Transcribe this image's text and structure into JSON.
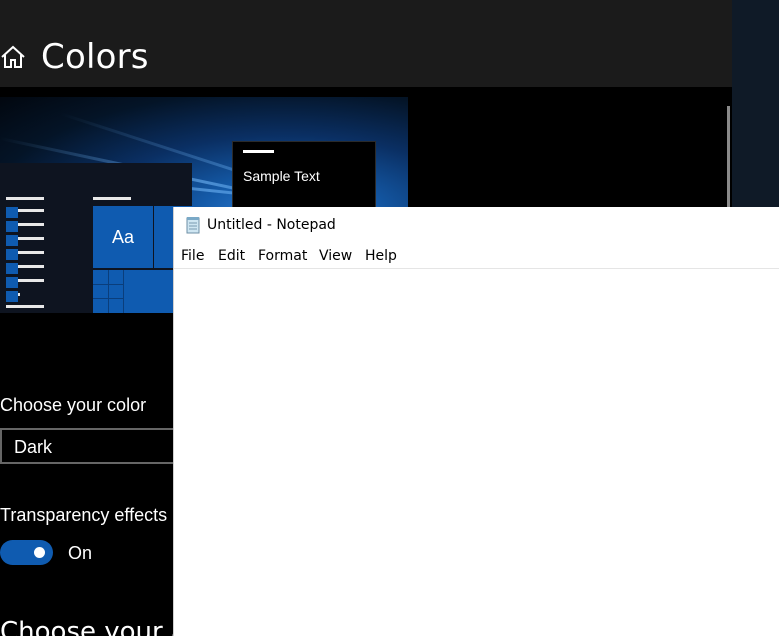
{
  "settings": {
    "title": "Colors",
    "home_icon": "home-icon",
    "preview": {
      "sample_text": "Sample Text",
      "tile_label": "Aa"
    },
    "choose_color_label": "Choose your color",
    "color_select_value": "Dark",
    "transparency_label": "Transparency effects",
    "transparency_state": "On",
    "next_heading": "Choose your acc",
    "accent_color": "#0f5bb0"
  },
  "notepad": {
    "title": "Untitled - Notepad",
    "icon": "notepad-icon",
    "menu": [
      "File",
      "Edit",
      "Format",
      "View",
      "Help"
    ]
  }
}
